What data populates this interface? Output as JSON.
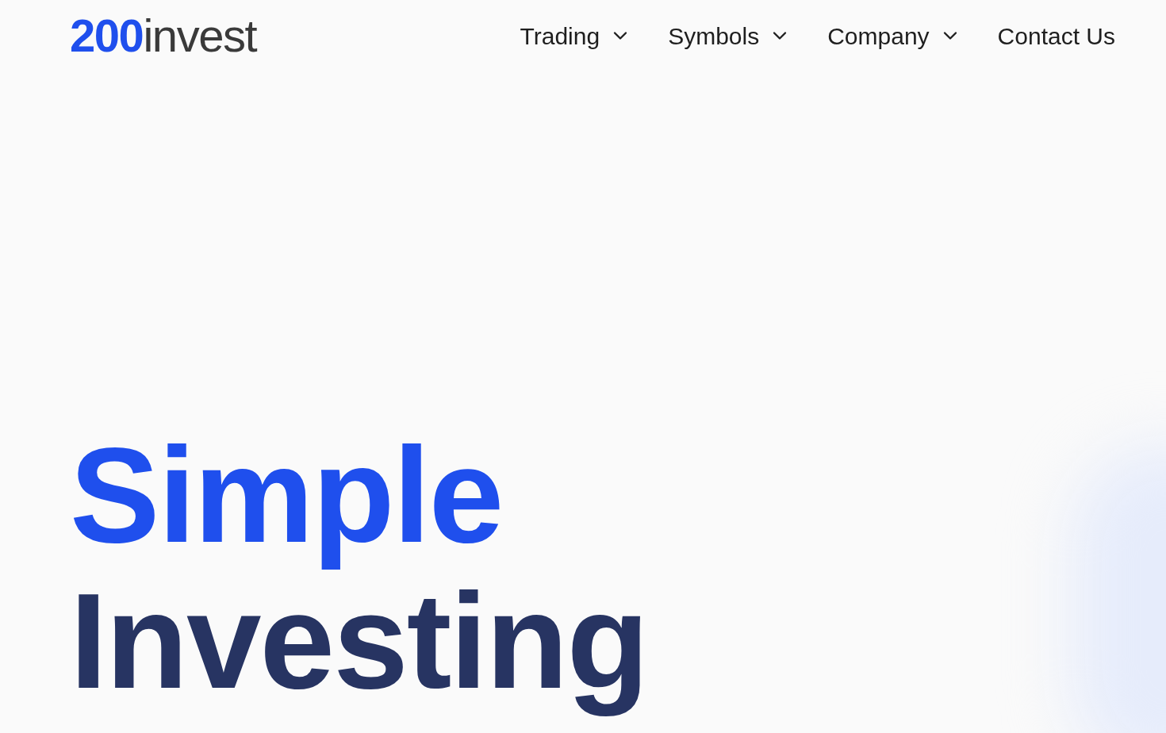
{
  "logo": {
    "mark": "200",
    "word": "invest"
  },
  "nav": [
    {
      "label": "Trading",
      "dropdown": true
    },
    {
      "label": "Symbols",
      "dropdown": true
    },
    {
      "label": "Company",
      "dropdown": true
    },
    {
      "label": "Contact Us",
      "dropdown": false
    }
  ],
  "hero": {
    "headline": [
      "Simple",
      "Investing"
    ]
  }
}
